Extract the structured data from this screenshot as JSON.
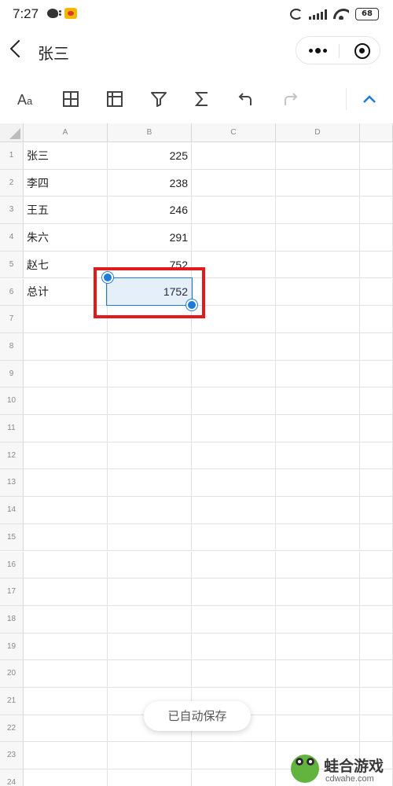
{
  "status_bar": {
    "time": "7:27",
    "battery": "68"
  },
  "header": {
    "title": "张三"
  },
  "toolbar": {
    "icons": [
      "text-format-icon",
      "border-icon",
      "freeze-icon",
      "filter-icon",
      "sum-icon",
      "undo-icon",
      "redo-icon",
      "collapse-icon"
    ]
  },
  "sheet": {
    "columns": [
      "A",
      "B",
      "C",
      "D"
    ],
    "row_numbers": [
      "1",
      "2",
      "3",
      "4",
      "5",
      "6",
      "7",
      "8",
      "9",
      "10",
      "11",
      "12",
      "13",
      "14",
      "15",
      "16",
      "17",
      "18",
      "19",
      "20",
      "21",
      "22",
      "23",
      "24"
    ],
    "rows": [
      {
        "a": "张三",
        "b": "225"
      },
      {
        "a": "李四",
        "b": "238"
      },
      {
        "a": "王五",
        "b": "246"
      },
      {
        "a": "朱六",
        "b": "291"
      },
      {
        "a": "赵七",
        "b": "752"
      },
      {
        "a": "总计",
        "b": "1752"
      }
    ],
    "selected_cell": "B6"
  },
  "toast": {
    "text": "已自动保存"
  },
  "watermark": {
    "title": "蛙合游戏",
    "url": "cdwahe.com"
  },
  "colors": {
    "selection": "#1e7bd8",
    "highlight_box": "#e11b1b",
    "accent": "#1e7bd8"
  }
}
